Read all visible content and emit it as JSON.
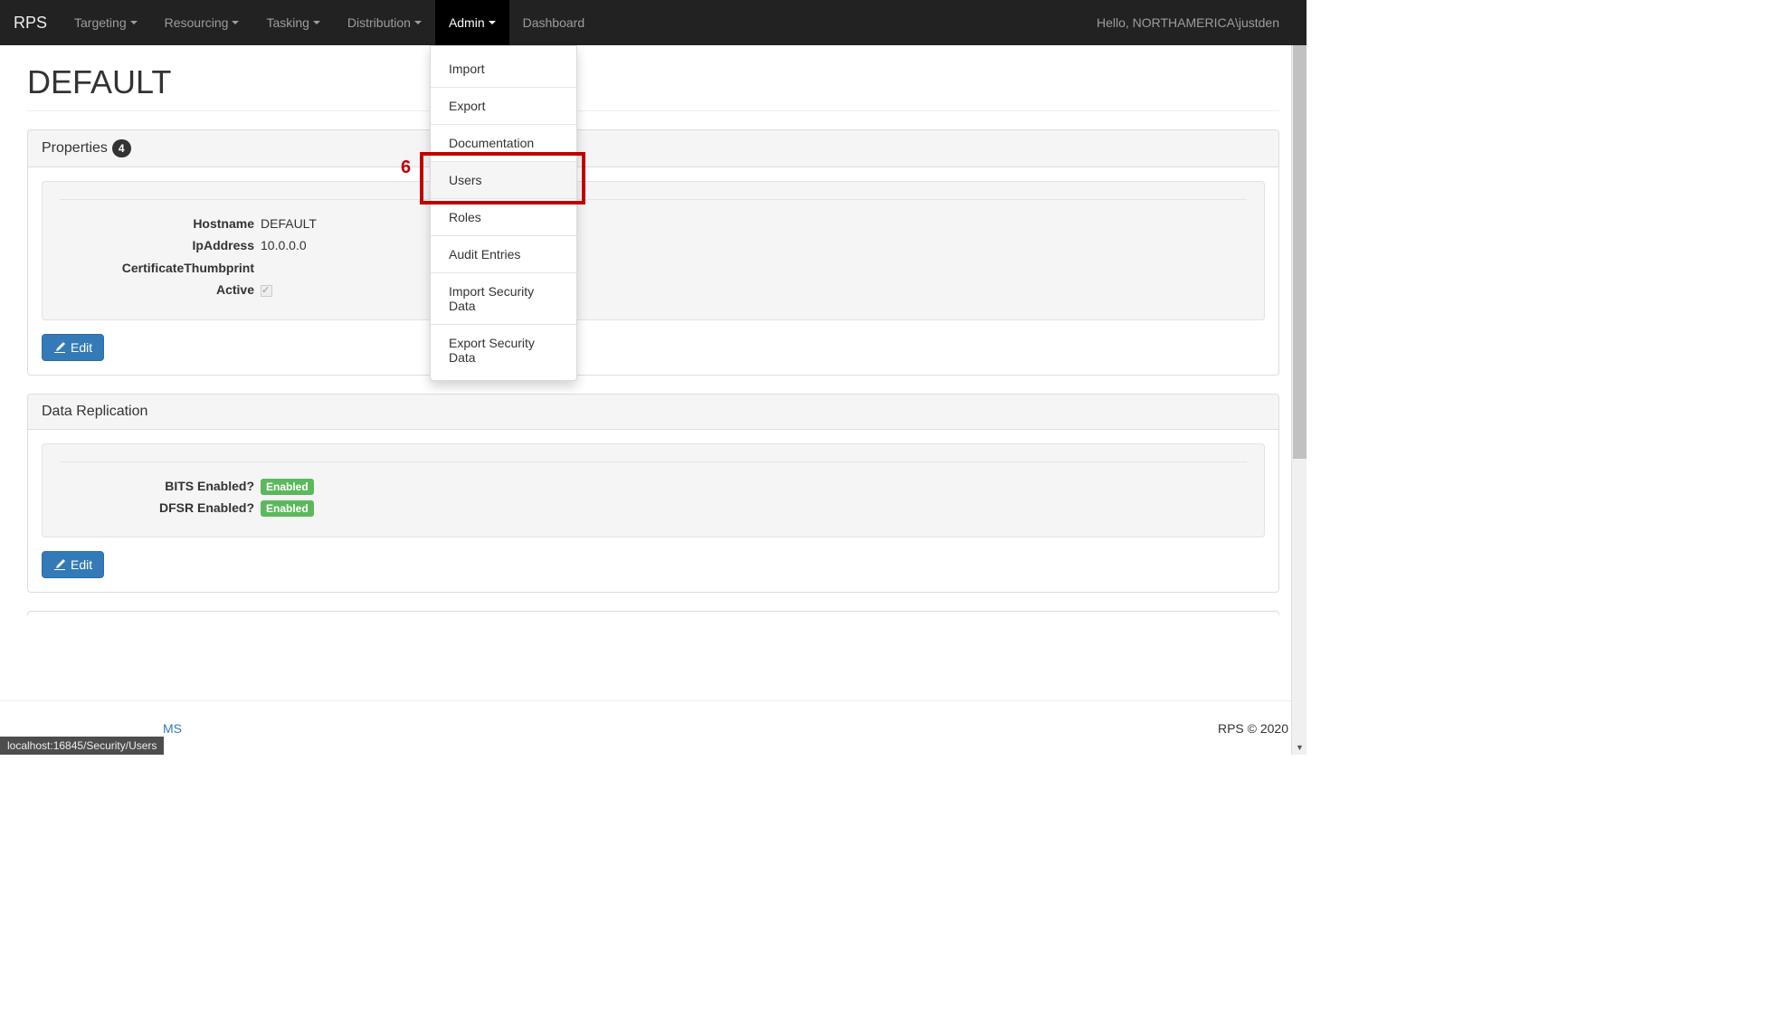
{
  "nav": {
    "brand": "RPS",
    "items": [
      {
        "label": "Targeting",
        "caret": true
      },
      {
        "label": "Resourcing",
        "caret": true
      },
      {
        "label": "Tasking",
        "caret": true
      },
      {
        "label": "Distribution",
        "caret": true
      },
      {
        "label": "Admin",
        "caret": true,
        "active": true
      },
      {
        "label": "Dashboard",
        "caret": false
      }
    ],
    "greeting": "Hello, NORTHAMERICA\\justden"
  },
  "admin_menu": [
    "Import",
    "Export",
    "Documentation",
    "Users",
    "Roles",
    "Audit Entries",
    "Import Security Data",
    "Export Security Data"
  ],
  "callout": {
    "number": "6"
  },
  "page": {
    "title": "DEFAULT"
  },
  "properties": {
    "heading": "Properties",
    "badge": "4",
    "fields": {
      "hostname_label": "Hostname",
      "hostname_value": "DEFAULT",
      "ip_label": "IpAddress",
      "ip_value": "10.0.0.0",
      "cert_label": "CertificateThumbprint",
      "cert_value": "",
      "active_label": "Active"
    },
    "edit_label": "Edit"
  },
  "replication": {
    "heading": "Data Replication",
    "fields": {
      "bits_label": "BITS Enabled?",
      "bits_status": "Enabled",
      "dfsr_label": "DFSR Enabled?",
      "dfsr_status": "Enabled"
    },
    "edit_label": "Edit"
  },
  "footer": {
    "link": "MS",
    "copyright": "RPS © 2020"
  },
  "status": "localhost:16845/Security/Users"
}
